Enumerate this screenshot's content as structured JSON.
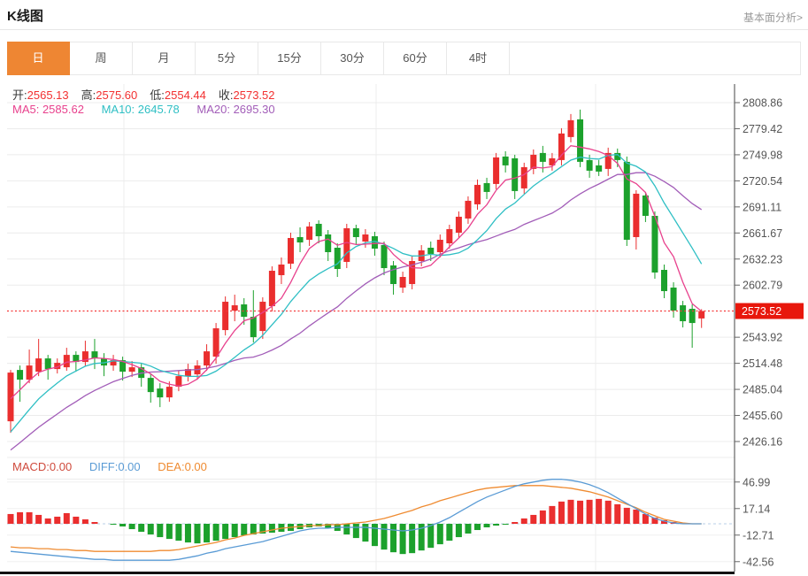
{
  "header": {
    "title": "K线图",
    "link": "基本面分析>"
  },
  "tabs": {
    "selected": "日",
    "items": [
      "日",
      "周",
      "月",
      "5分",
      "15分",
      "30分",
      "60分",
      "4时"
    ]
  },
  "ohlc": {
    "open_label": "开:",
    "open": "2565.13",
    "high_label": "高:",
    "high": "2575.60",
    "low_label": "低:",
    "low": "2554.44",
    "close_label": "收:",
    "close": "2573.52"
  },
  "ma_legend": {
    "ma5": "MA5: 2585.62",
    "ma10": "MA10: 2645.78",
    "ma20": "MA20: 2695.30"
  },
  "macd_legend": {
    "macd": "MACD:0.00",
    "diff": "DIFF:0.00",
    "dea": "DEA:0.00"
  },
  "colors": {
    "up": "#ea2e2e",
    "down": "#1ca12c",
    "ma5": "#e8418d",
    "ma10": "#2fbfc4",
    "ma20": "#a25db8",
    "diff": "#5a9bd5",
    "dea": "#ef8b31",
    "tab_accent": "#ee8633",
    "price_line": "#f43b3b",
    "badge_bg": "#e8170c",
    "badge_text": "#ffffff",
    "grid": "#ececec",
    "axis": "#444444",
    "tick_text": "#555555"
  },
  "chart_data": {
    "type": "candlestick",
    "title": "K线图",
    "panels": [
      "price+MA(5,10,20)",
      "MACD(hist,DIFF,DEA)"
    ],
    "price_axis_ticks": [
      2808.86,
      2779.42,
      2749.98,
      2720.54,
      2691.11,
      2661.67,
      2632.23,
      2602.79,
      2543.92,
      2514.48,
      2485.04,
      2455.6,
      2426.16
    ],
    "last_price": 2573.52,
    "last_candle": {
      "open": 2565.13,
      "high": 2575.6,
      "low": 2554.44,
      "close": 2573.52
    },
    "ma_values": {
      "MA5": 2585.62,
      "MA10": 2645.78,
      "MA20": 2695.3
    },
    "ma_periods": [
      5,
      10,
      20
    ],
    "candle_format": [
      "open",
      "close",
      "low",
      "high"
    ],
    "candles": [
      [
        2449,
        2504,
        2436,
        2507
      ],
      [
        2507,
        2496,
        2471,
        2512
      ],
      [
        2496,
        2512,
        2492,
        2530
      ],
      [
        2505,
        2520,
        2500,
        2542
      ],
      [
        2520,
        2508,
        2496,
        2524
      ],
      [
        2508,
        2515,
        2503,
        2520
      ],
      [
        2510,
        2524,
        2506,
        2532
      ],
      [
        2524,
        2516,
        2505,
        2528
      ],
      [
        2516,
        2528,
        2511,
        2540
      ],
      [
        2528,
        2520,
        2508,
        2542
      ],
      [
        2520,
        2512,
        2500,
        2526
      ],
      [
        2512,
        2518,
        2506,
        2524
      ],
      [
        2518,
        2505,
        2495,
        2522
      ],
      [
        2505,
        2510,
        2499,
        2517
      ],
      [
        2510,
        2498,
        2488,
        2514
      ],
      [
        2498,
        2482,
        2470,
        2502
      ],
      [
        2486,
        2476,
        2465,
        2492
      ],
      [
        2476,
        2488,
        2471,
        2494
      ],
      [
        2488,
        2500,
        2483,
        2506
      ],
      [
        2500,
        2508,
        2494,
        2514
      ],
      [
        2502,
        2512,
        2496,
        2518
      ],
      [
        2512,
        2528,
        2506,
        2536
      ],
      [
        2522,
        2554,
        2514,
        2560
      ],
      [
        2552,
        2584,
        2546,
        2590
      ],
      [
        2574,
        2580,
        2562,
        2592
      ],
      [
        2581,
        2567,
        2558,
        2588
      ],
      [
        2567,
        2544,
        2538,
        2597
      ],
      [
        2551,
        2584,
        2542,
        2589
      ],
      [
        2579,
        2619,
        2573,
        2624
      ],
      [
        2614,
        2626,
        2604,
        2634
      ],
      [
        2627,
        2656,
        2621,
        2662
      ],
      [
        2657,
        2651,
        2640,
        2668
      ],
      [
        2654,
        2669,
        2647,
        2674
      ],
      [
        2672,
        2658,
        2650,
        2676
      ],
      [
        2660,
        2640,
        2630,
        2665
      ],
      [
        2645,
        2621,
        2612,
        2650
      ],
      [
        2629,
        2667,
        2622,
        2672
      ],
      [
        2667,
        2657,
        2649,
        2671
      ],
      [
        2652,
        2660,
        2645,
        2666
      ],
      [
        2658,
        2644,
        2636,
        2663
      ],
      [
        2648,
        2622,
        2614,
        2652
      ],
      [
        2625,
        2604,
        2592,
        2630
      ],
      [
        2600,
        2612,
        2594,
        2618
      ],
      [
        2604,
        2630,
        2598,
        2636
      ],
      [
        2630,
        2642,
        2624,
        2648
      ],
      [
        2645,
        2638,
        2630,
        2652
      ],
      [
        2640,
        2654,
        2634,
        2660
      ],
      [
        2650,
        2666,
        2644,
        2671
      ],
      [
        2662,
        2680,
        2656,
        2686
      ],
      [
        2678,
        2698,
        2672,
        2703
      ],
      [
        2694,
        2716,
        2688,
        2722
      ],
      [
        2718,
        2708,
        2700,
        2724
      ],
      [
        2717,
        2747,
        2711,
        2752
      ],
      [
        2748,
        2738,
        2730,
        2754
      ],
      [
        2746,
        2709,
        2700,
        2750
      ],
      [
        2712,
        2736,
        2706,
        2741
      ],
      [
        2734,
        2750,
        2728,
        2756
      ],
      [
        2752,
        2742,
        2730,
        2760
      ],
      [
        2738,
        2746,
        2732,
        2752
      ],
      [
        2744,
        2774,
        2738,
        2780
      ],
      [
        2770,
        2789,
        2764,
        2796
      ],
      [
        2790,
        2742,
        2736,
        2801
      ],
      [
        2744,
        2732,
        2724,
        2750
      ],
      [
        2738,
        2731,
        2726,
        2744
      ],
      [
        2734,
        2752,
        2726,
        2758
      ],
      [
        2752,
        2744,
        2736,
        2757
      ],
      [
        2742,
        2654,
        2647,
        2748
      ],
      [
        2657,
        2706,
        2643,
        2710
      ],
      [
        2704,
        2681,
        2674,
        2708
      ],
      [
        2681,
        2617,
        2610,
        2686
      ],
      [
        2620,
        2596,
        2588,
        2626
      ],
      [
        2600,
        2574,
        2566,
        2606
      ],
      [
        2580,
        2562,
        2555,
        2585
      ],
      [
        2576,
        2560,
        2532,
        2581
      ],
      [
        2565.13,
        2573.52,
        2554.44,
        2575.6
      ]
    ],
    "macd": {
      "MACD": 0.0,
      "DIFF": 0.0,
      "DEA": 0.0,
      "axis_ticks": [
        46.99,
        17.14,
        -12.71,
        -42.56
      ],
      "hist": [
        11,
        13,
        13,
        10,
        6,
        8,
        12,
        8,
        5,
        2,
        0,
        -1,
        -3,
        -6,
        -9,
        -12,
        -15,
        -17,
        -19,
        -21,
        -22,
        -21,
        -19,
        -17,
        -15,
        -13,
        -12,
        -11,
        -10,
        -9,
        -8,
        -6,
        -4,
        -3,
        -5,
        -8,
        -12,
        -16,
        -20,
        -25,
        -29,
        -32,
        -34,
        -33,
        -30,
        -27,
        -23,
        -19,
        -15,
        -11,
        -7,
        -4,
        -2,
        -1,
        2,
        6,
        10,
        15,
        20,
        25,
        27,
        26,
        27,
        28,
        26,
        22,
        18,
        16,
        11,
        7,
        4,
        2,
        1,
        0,
        0
      ],
      "diff_line": [
        -31,
        -32,
        -33,
        -34,
        -35,
        -36,
        -37,
        -38,
        -39,
        -40,
        -40,
        -41,
        -41,
        -41,
        -41,
        -41,
        -41,
        -41,
        -40,
        -38,
        -36,
        -33,
        -31,
        -28,
        -26,
        -24,
        -22,
        -20,
        -17,
        -14,
        -11,
        -8,
        -6,
        -5,
        -5,
        -4,
        -4,
        -4,
        -4,
        -5,
        -6,
        -7,
        -8,
        -7,
        -5,
        -2,
        2,
        7,
        13,
        19,
        25,
        30,
        34,
        38,
        42,
        45,
        47,
        49,
        50,
        50,
        49,
        47,
        44,
        40,
        35,
        29,
        23,
        17,
        11,
        6,
        3,
        1,
        0,
        0,
        0
      ],
      "dea_line": [
        -26,
        -27,
        -27,
        -28,
        -28,
        -29,
        -29,
        -30,
        -30,
        -31,
        -31,
        -31,
        -31,
        -31,
        -31,
        -31,
        -30,
        -30,
        -29,
        -27,
        -25,
        -23,
        -21,
        -18,
        -16,
        -13,
        -11,
        -9,
        -7,
        -5,
        -4,
        -3,
        -2,
        -2,
        -1,
        -1,
        0,
        1,
        2,
        4,
        6,
        9,
        12,
        15,
        19,
        22,
        26,
        29,
        32,
        35,
        38,
        40,
        41,
        42,
        43,
        43,
        43,
        43,
        42,
        41,
        40,
        38,
        36,
        33,
        30,
        26,
        22,
        18,
        13,
        9,
        5,
        3,
        1,
        0,
        0
      ]
    }
  }
}
